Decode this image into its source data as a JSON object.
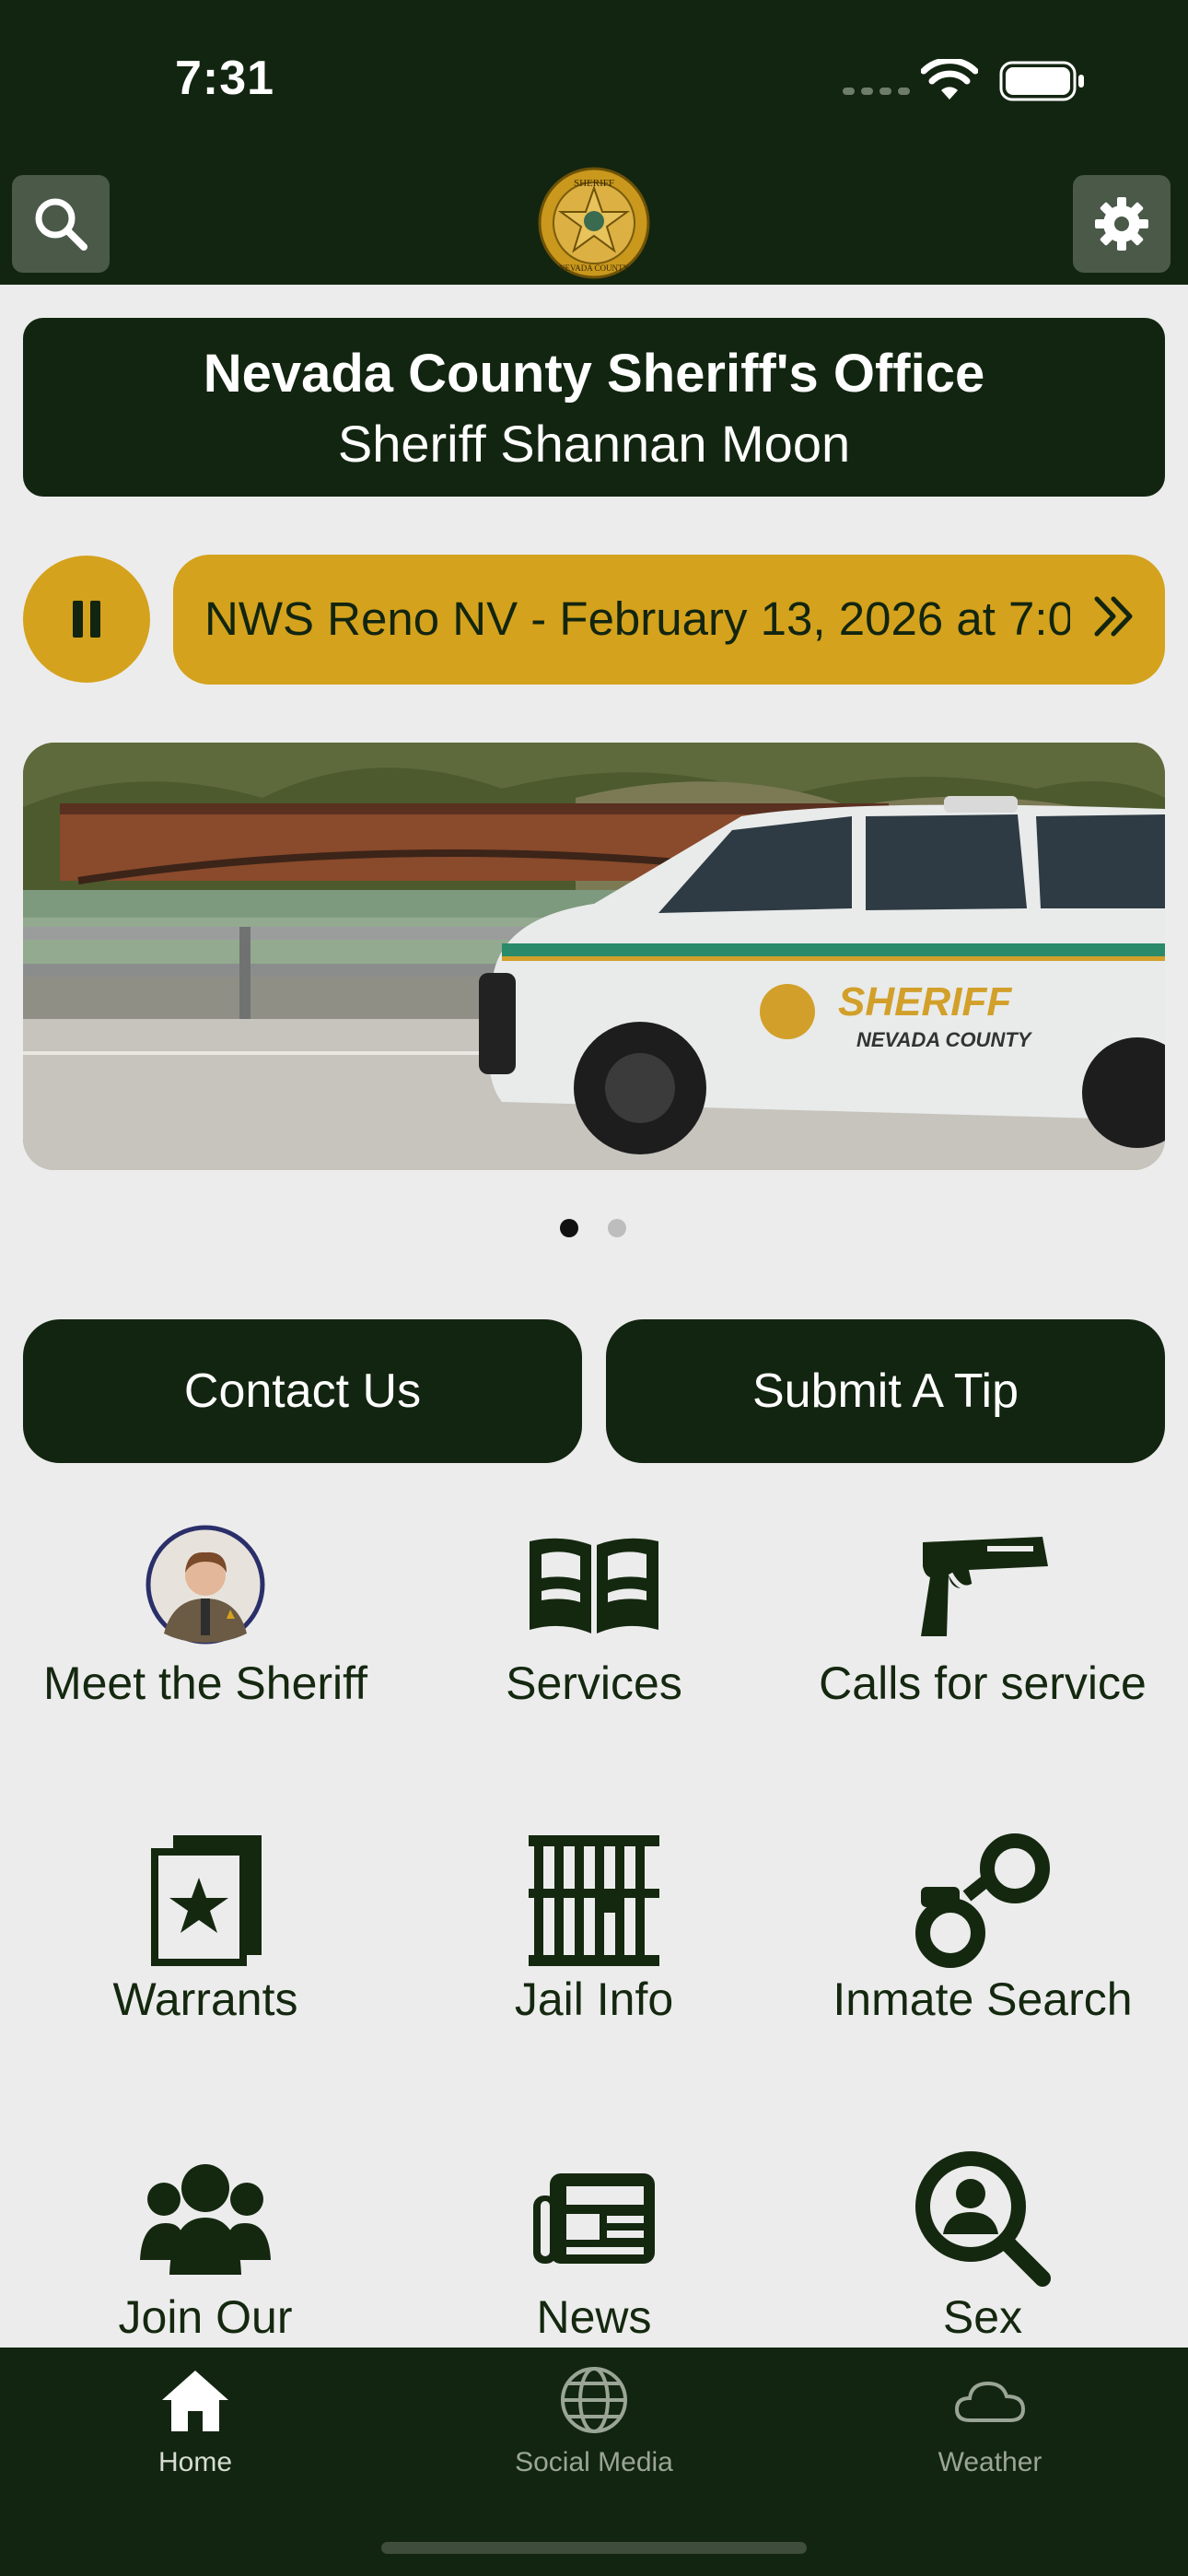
{
  "status_bar": {
    "time": "7:31"
  },
  "header": {
    "badge": {
      "top_text": "SHERIFF",
      "bottom_text": "NEVADA COUNTY",
      "icon": "sheriff-star-badge"
    },
    "search_icon": "search-icon",
    "settings_icon": "gear-icon"
  },
  "title_card": {
    "title": "Nevada County Sheriff's Office",
    "subtitle": "Sheriff Shannan Moon"
  },
  "ticker": {
    "text": "NWS Reno NV - February 13, 2026 at 7:0",
    "pause_icon": "pause-icon",
    "more_icon": "double-chevron-right-icon"
  },
  "hero": {
    "carousel_page": 1,
    "carousel_pages": 2,
    "vehicle_text": "SHERIFF",
    "vehicle_subtext": "NEVADA COUNTY"
  },
  "actions": {
    "contact": "Contact Us",
    "tip": "Submit A Tip"
  },
  "grid": [
    {
      "label": "Meet the Sheriff",
      "icon": "sheriff-portrait"
    },
    {
      "label": "Services",
      "icon": "book-icon"
    },
    {
      "label": "Calls for service",
      "icon": "handgun-icon"
    },
    {
      "label": "Warrants",
      "icon": "star-document-icon"
    },
    {
      "label": "Jail Info",
      "icon": "jail-cell-icon"
    },
    {
      "label": "Inmate Search",
      "icon": "handcuffs-icon"
    },
    {
      "label": "Join Our",
      "icon": "group-icon"
    },
    {
      "label": "News",
      "icon": "newspaper-icon"
    },
    {
      "label": "Sex",
      "icon": "search-person-icon"
    }
  ],
  "tabs": [
    {
      "label": "Home",
      "icon": "home-icon",
      "active": true
    },
    {
      "label": "Social Media",
      "icon": "globe-icon",
      "active": false
    },
    {
      "label": "Weather",
      "icon": "cloud-icon",
      "active": false
    }
  ],
  "colors": {
    "primary": "#122510",
    "accent": "#d4a21c",
    "background": "#ececec"
  }
}
